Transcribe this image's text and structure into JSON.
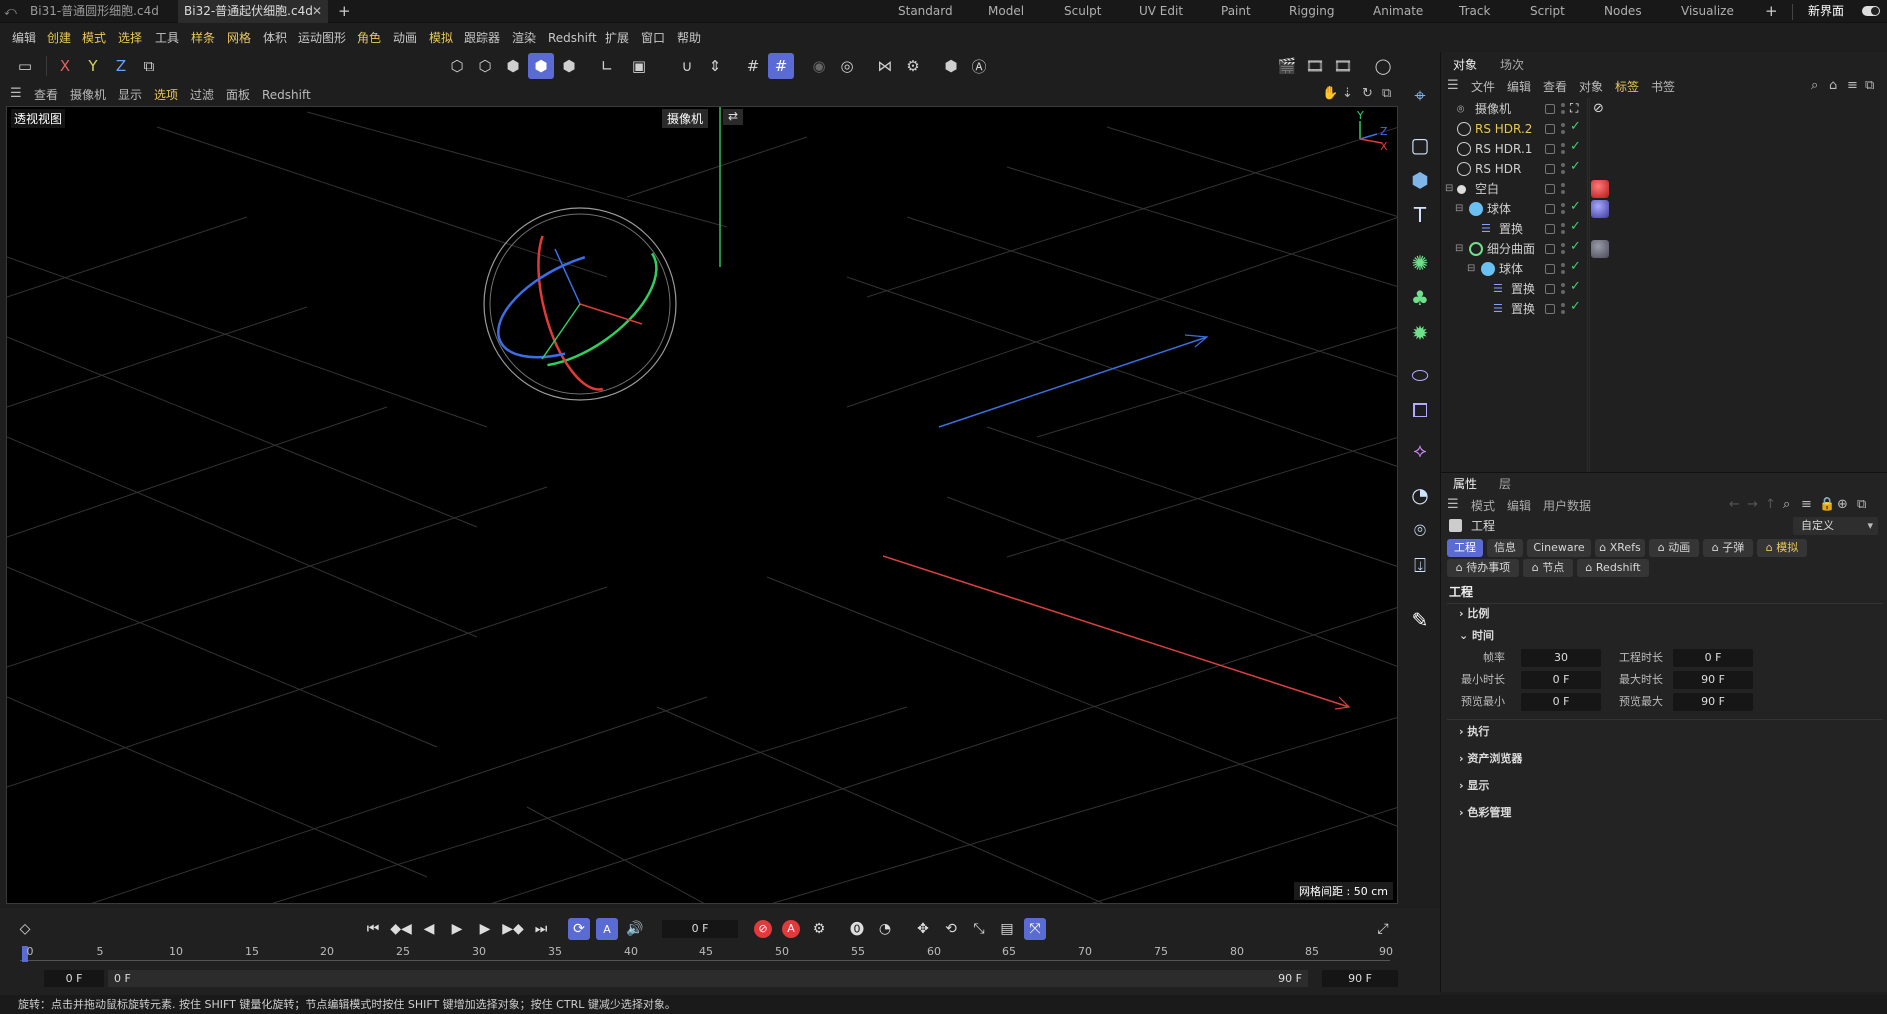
{
  "file_tabs": [
    {
      "label": "Bi31-普通圆形细胞.c4d",
      "active": false
    },
    {
      "label": "Bi32-普通起伏细胞.c4d",
      "active": true
    }
  ],
  "layout_tabs": [
    "Standard",
    "Model",
    "Sculpt",
    "UV Edit",
    "Paint",
    "Rigging",
    "Animate",
    "Track",
    "Script",
    "Nodes",
    "Visualize"
  ],
  "new_layout_label": "新界面",
  "menus": [
    "编辑",
    "创建",
    "模式",
    "选择",
    "工具",
    "样条",
    "网格",
    "体积",
    "运动图形",
    "角色",
    "动画",
    "模拟",
    "跟踪器",
    "渲染",
    "Redshift",
    "扩展",
    "窗口",
    "帮助"
  ],
  "toolbar": {
    "x": "X",
    "y": "Y",
    "z": "Z"
  },
  "viewport": {
    "menu": [
      "查看",
      "摄像机",
      "显示",
      "选项",
      "过滤",
      "面板",
      "Redshift"
    ],
    "label": "透视视图",
    "camera_label": "摄像机",
    "grid_label": "网格间距 : 50 cm",
    "axis_y": "Y",
    "axis_z": "Z",
    "axis_x": "X"
  },
  "object_manager": {
    "tabs": [
      "对象",
      "场次"
    ],
    "menu": [
      "文件",
      "编辑",
      "查看",
      "对象",
      "标签",
      "书签"
    ],
    "objects": [
      {
        "name": "摄像机",
        "color": "#cfcfcf"
      },
      {
        "name": "RS HDR.2",
        "color": "#e8c75a"
      },
      {
        "name": "RS HDR.1",
        "color": "#cfcfcf"
      },
      {
        "name": "RS HDR",
        "color": "#cfcfcf"
      },
      {
        "name": "空白",
        "color": "#cfcfcf"
      },
      {
        "name": "球体",
        "color": "#cfcfcf"
      },
      {
        "name": "置换",
        "color": "#cfcfcf"
      },
      {
        "name": "细分曲面",
        "color": "#cfcfcf"
      },
      {
        "name": "球体",
        "color": "#cfcfcf"
      },
      {
        "name": "置换",
        "color": "#cfcfcf"
      },
      {
        "name": "置换",
        "color": "#cfcfcf"
      }
    ]
  },
  "attributes": {
    "tabs": [
      "属性",
      "层"
    ],
    "menu": [
      "模式",
      "编辑",
      "用户数据"
    ],
    "object_title": "工程",
    "preset": "自定义",
    "chips_row1": [
      "工程",
      "信息",
      "Cineware",
      "XRefs",
      "动画",
      "子弹",
      "模拟"
    ],
    "chips_row2": [
      "待办事项",
      "节点",
      "Redshift"
    ],
    "section_title": "工程",
    "groups": [
      "比例",
      "时间",
      "执行",
      "资产浏览器",
      "显示",
      "色彩管理"
    ],
    "time": {
      "fps_label": "帧率",
      "fps": "30",
      "project_len_label": "工程时长",
      "project_len": "0 F",
      "min_time_label": "最小时长",
      "min_time": "0 F",
      "max_time_label": "最大时长",
      "max_time": "90 F",
      "preview_min_label": "预览最小",
      "preview_min": "0 F",
      "preview_max_label": "预览最大",
      "preview_max": "90 F"
    }
  },
  "timeline": {
    "current_frame": "0 F",
    "ticks": [
      "0",
      "5",
      "10",
      "15",
      "20",
      "25",
      "30",
      "35",
      "40",
      "45",
      "50",
      "55",
      "60",
      "65",
      "70",
      "75",
      "80",
      "85",
      "90"
    ],
    "range_start": "0 F",
    "range_start2": "0 F",
    "range_end": "90 F",
    "range_end2": "90 F"
  },
  "status_text": "旋转：点击并拖动鼠标旋转元素. 按住 SHIFT 键量化旋转；节点编辑模式时按住 SHIFT 键增加选择对象；按住 CTRL 键减少选择对象。"
}
